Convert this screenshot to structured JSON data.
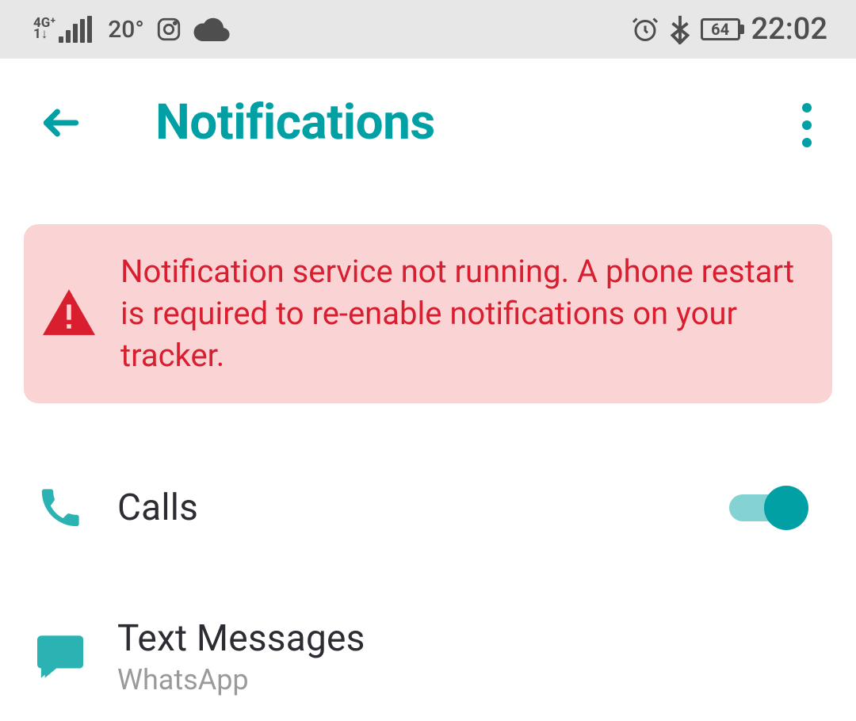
{
  "status": {
    "network_label_top": "4G⁺",
    "network_label_bottom": "1↓",
    "temperature": "20°",
    "battery": "64",
    "time": "22:02"
  },
  "header": {
    "title": "Notifications"
  },
  "warning": {
    "message": "Notification service not running. A phone restart is required to re-enable notifications on your tracker."
  },
  "items": [
    {
      "label": "Calls",
      "sub": "",
      "toggle_on": true
    },
    {
      "label": "Text Messages",
      "sub": "WhatsApp"
    }
  ]
}
